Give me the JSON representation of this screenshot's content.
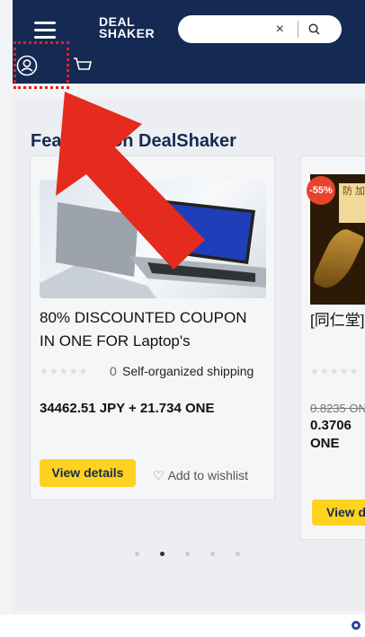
{
  "header": {
    "logo_line1": "DEAL",
    "logo_line2": "SHAKER",
    "search_clear": "×"
  },
  "section": {
    "title": "Featured on DealShaker"
  },
  "card1": {
    "title": "80% DISCOUNTED COUPON IN ONE FOR Laptop's",
    "rating_count": "0",
    "shipping": "Self-organized shipping",
    "price": "34462.51 JPY + 21.734 ONE",
    "view_label": "View details",
    "wishlist_label": "Add to wishlist"
  },
  "card2": {
    "discount_badge": "-55%",
    "tag": "防 加",
    "title_start": "[同仁堂]",
    "old_price": "0.8235 ON",
    "new_price": "0.3706",
    "currency": "ONE",
    "view_label": "View de"
  },
  "carousel": {
    "active_index": 1
  },
  "colors": {
    "header_bg": "#152a52",
    "button_yellow": "#ffd21f",
    "arrow_red": "#e52a1e"
  },
  "icons": [
    "menu-icon",
    "search-icon",
    "user-icon",
    "cart-icon",
    "heart-icon"
  ]
}
